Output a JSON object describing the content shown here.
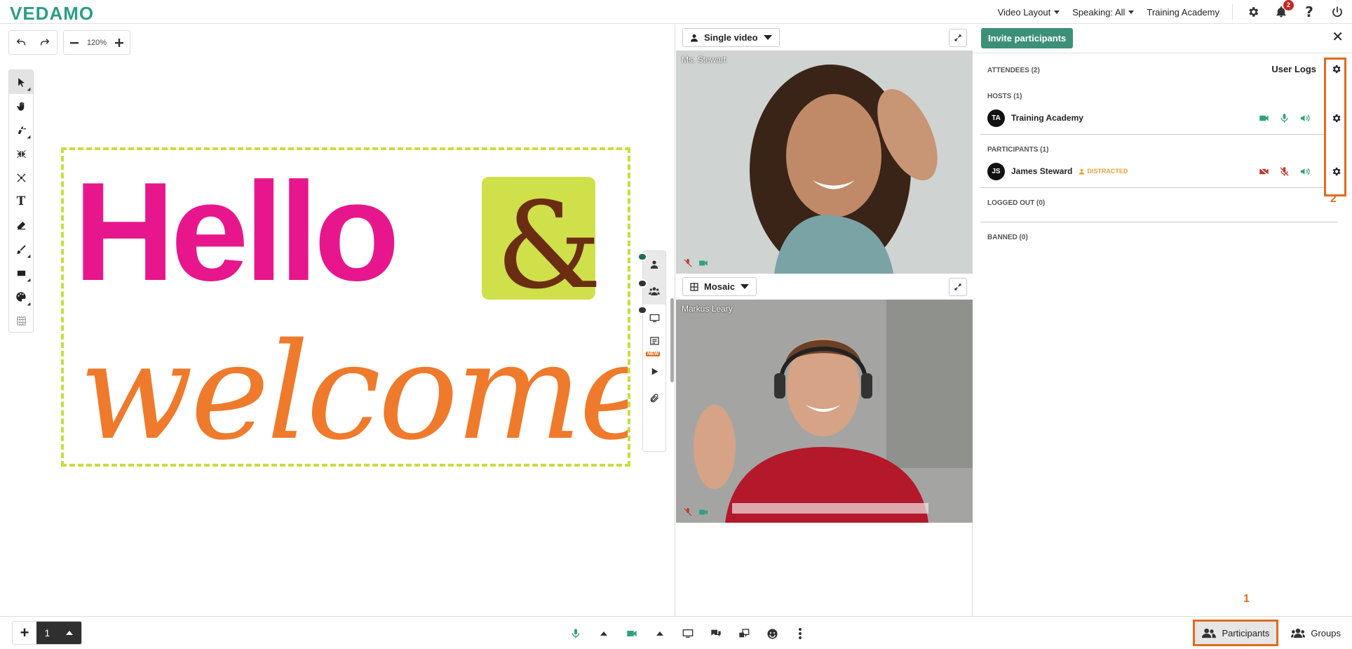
{
  "app": {
    "logo": "VEDAMO"
  },
  "topbar": {
    "video_layout": "Video Layout",
    "speaking": "Speaking: All",
    "account": "Training Academy",
    "notifications_count": "2"
  },
  "whiteboard": {
    "zoom": "120%",
    "tools": [
      "select",
      "pan",
      "laser-pointer",
      "shrink",
      "expand-points",
      "text",
      "eraser",
      "brush",
      "shape",
      "color-palette",
      "grid"
    ],
    "content": {
      "line1": "Hello",
      "ampersand": "&",
      "line2": "welcome"
    },
    "colors": {
      "pink": "#e8168c",
      "lime": "#cfe04a",
      "brown": "#6b2d12",
      "orange": "#ef7a2c",
      "dash": "#c9dd3c"
    },
    "side_panel": {
      "new_label": "NEW"
    },
    "page_number": "1"
  },
  "video": {
    "top": {
      "layout_label": "Single video",
      "participant": "Ms. Stewart"
    },
    "bottom": {
      "layout_label": "Mosaic",
      "participant": "Markus Leary"
    }
  },
  "participants_panel": {
    "invite_label": "Invite participants",
    "attendees": "ATTENDEES (2)",
    "user_logs": "User Logs",
    "hosts_header": "HOSTS (1)",
    "hosts": [
      {
        "initials": "TA",
        "name": "Training Academy"
      }
    ],
    "participants_header": "PARTICIPANTS (1)",
    "participants": [
      {
        "initials": "JS",
        "name": "James Steward",
        "status": "DISTRACTED"
      }
    ],
    "logged_out": "LOGGED OUT (0)",
    "banned": "BANNED (0)",
    "annotation_1": "1",
    "annotation_2": "2"
  },
  "bottombar": {
    "participants_label": "Participants",
    "groups_label": "Groups"
  },
  "accent": {
    "green": "#3c9078",
    "orange": "#e26b1b",
    "status_orange": "#e8a135",
    "muted_red": "#c0392b"
  }
}
